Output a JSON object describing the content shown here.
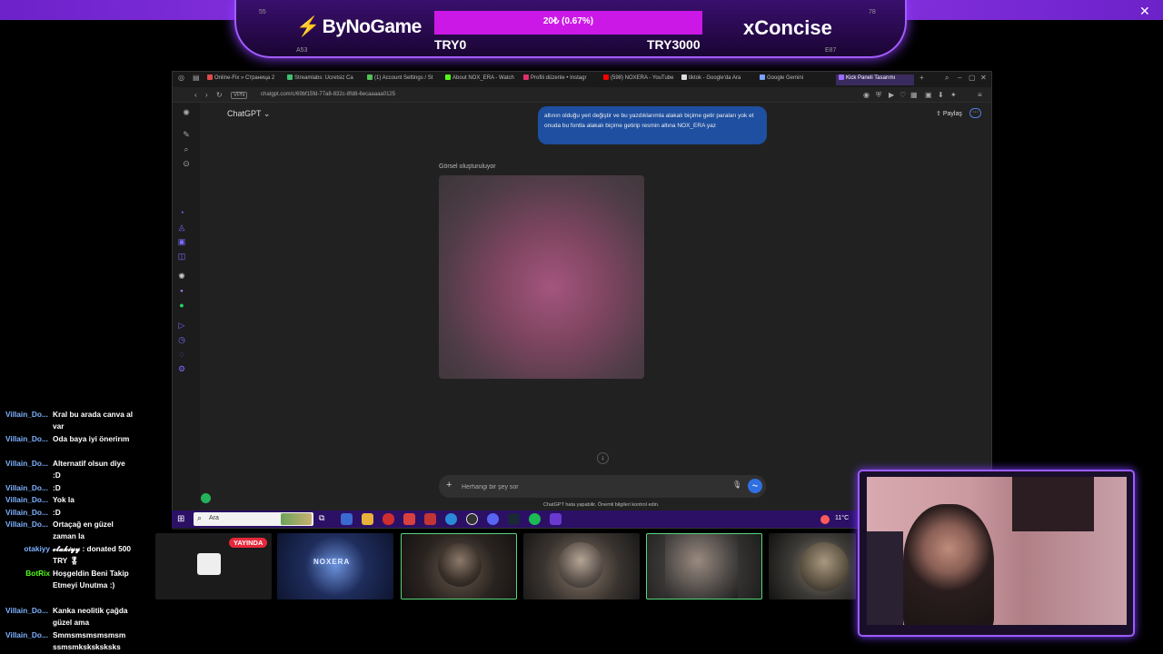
{
  "banner": {
    "brand_left": "ByNoGame",
    "brand_right": "xConcise",
    "goal_text": "20₺ (0.67%)",
    "goal_progress_percent": 0.67,
    "goal_min": "TRY0",
    "goal_max": "TRY3000",
    "left_small_top": "55",
    "left_small_bottom": "A53",
    "right_small_top": "78",
    "right_small_bottom": "E87",
    "accent_color": "#a45cff",
    "goal_bar_color": "#cc18e6"
  },
  "browser": {
    "tabs": [
      {
        "label": "Online-Fix » Страница 2",
        "color": "#e04a4a"
      },
      {
        "label": "Streamlabs: Ücretsiz Ca",
        "color": "#40c070"
      },
      {
        "label": "(1) Account Settings / St",
        "color": "#53c05a"
      },
      {
        "label": "About NOX_ERA - Watch",
        "color": "#53fc18"
      },
      {
        "label": "Profili düzenle • Instagr",
        "color": "#e1306c"
      },
      {
        "label": "(598) NOXERA - YouTube",
        "color": "#ff0000"
      },
      {
        "label": "tiktok - Google'da Ara",
        "color": "#dddddd"
      },
      {
        "label": "Google Gemini",
        "color": "#7aa2ff"
      },
      {
        "label": "Kick Paneli Tasarımı",
        "color": "#9c6bff",
        "active": true
      }
    ],
    "url": "chatgpt.com/c/69bf15fd-77a8-832c-8fd8-6ecaaaaa0125",
    "vpn_label": "VPN"
  },
  "chatgpt": {
    "title": "ChatGPT",
    "share_label": "Paylaş",
    "more_label": "···",
    "user_message": "altının olduğu yeri değiştir ve bu yazdıklarımla alakalı biçime getir paraları yok et onuda bu fontla alakalı biçime getirip resmin altına NOX_ERA yaz",
    "generating_label": "Görsel oluşturuluyor",
    "composer_placeholder": "Herhangi bir şey sor",
    "disclaimer": "ChatGPT hata yapabilir. Önemli bilgileri kontrol edin."
  },
  "taskbar": {
    "search_label": "Ara",
    "weather": "11°C",
    "icons": [
      "start-icon",
      "task-view-icon",
      "files-icon",
      "store-icon",
      "browser-icon",
      "app-icon",
      "edge-icon",
      "obs-icon",
      "discord-icon",
      "steam-icon",
      "spotify-icon",
      "app2-icon"
    ]
  },
  "chat": [
    {
      "user": "Villain_Do...",
      "msg": "Kral bu arada canva al var"
    },
    {
      "user": "Villain_Do...",
      "msg": "Oda baya iyi önerirım"
    },
    {
      "user": "Villain_Do...",
      "msg": "Alternatif olsun diye :D"
    },
    {
      "user": "Villain_Do...",
      "msg": ":D"
    },
    {
      "user": "Villain_Do...",
      "msg": "Yok la"
    },
    {
      "user": "Villain_Do...",
      "msg": ":D"
    },
    {
      "user": "Villain_Do...",
      "msg": "Ortaçağ en güzel zaman la"
    },
    {
      "user": "otakiyy",
      "msg": "𝓸𝓽𝓪𝓴𝓲𝔂𝔂 : donated 500 TRY 🎖",
      "user_color": "#7fb2ff"
    },
    {
      "user": "BotRix",
      "msg": "Hoşgeldin Beni Takip Etmeyi Unutma :)",
      "user_color": "#53fc18"
    },
    {
      "user": "Villain_Do...",
      "msg": "Kanka neolitik çağda güzel ama"
    },
    {
      "user": "Villain_Do...",
      "msg": "Smmsmsmsmsmsm ssmsmksksksksks"
    }
  ],
  "stream": {
    "live_badge": "YAYINDA",
    "noxera_logo": "NOXERA"
  }
}
